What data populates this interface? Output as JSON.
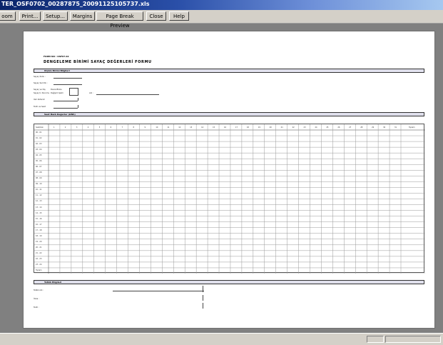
{
  "window": {
    "title": "TER_OSF0702_00287875_20091125105737.xls"
  },
  "toolbar": {
    "buttons": [
      {
        "id": "zoom",
        "label": "oom"
      },
      {
        "id": "print",
        "label": "Print..."
      },
      {
        "id": "setup",
        "label": "Setup..."
      },
      {
        "id": "margins",
        "label": "Margins"
      },
      {
        "id": "page-break-preview",
        "label": "Page Break Preview"
      },
      {
        "id": "close",
        "label": "Close"
      },
      {
        "id": "help",
        "label": "Help"
      }
    ]
  },
  "form": {
    "form_no": "FORM NO : OSF07.02",
    "title": "DENGELEME BİRİMİ SAYAÇ DEĞERLERİ FORMU",
    "section1": {
      "header": "Olçüm Birimi Bilgileri",
      "fields": [
        "Sayaç Kodu :",
        "Sayaç Seri No :",
        "Sayaç ve Dış",
        "Sayaç'ın Durumu",
        "Veri Aktarım",
        "Tarih ve Saat"
      ],
      "extra_left": [
        "Devre Bloku",
        "Değişim Şekli"
      ],
      "extra_right": "Adı :"
    },
    "section2": {
      "header": "Saat Bazlı Değerler (kWh)"
    },
    "grid": {
      "first_col_header": "Saat/Gün",
      "day_numbers": [
        "1",
        "2",
        "3",
        "4",
        "5",
        "6",
        "7",
        "8",
        "9",
        "10",
        "11",
        "12",
        "13",
        "14",
        "15",
        "16",
        "17",
        "18",
        "19",
        "20",
        "21",
        "22",
        "23",
        "24",
        "25",
        "26",
        "27",
        "28",
        "29",
        "30",
        "31"
      ],
      "total_header": "Toplam",
      "hours": [
        "00 - 01",
        "01 - 02",
        "02 - 03",
        "03 - 04",
        "04 - 05",
        "05 - 06",
        "06 - 07",
        "07 - 08",
        "08 - 09",
        "09 - 10",
        "10 - 11",
        "11 - 12",
        "12 - 13",
        "13 - 14",
        "14 - 15",
        "15 - 16",
        "16 - 17",
        "17 - 18",
        "18 - 19",
        "19 - 20",
        "20 - 21",
        "21 - 22",
        "22 - 23",
        "23 - 24",
        "Toplam"
      ]
    },
    "section3": {
      "header": "Tetkik Bilgileri",
      "fields": [
        "Tetkik Adı :",
        "İmza :",
        "Tarih :"
      ]
    }
  },
  "colors": {
    "title_bar_start": "#0a246a",
    "title_bar_end": "#a6c8f0",
    "section_header_fill": "#e0e0ec",
    "chrome": "#d4d0c8",
    "background": "#808080"
  }
}
